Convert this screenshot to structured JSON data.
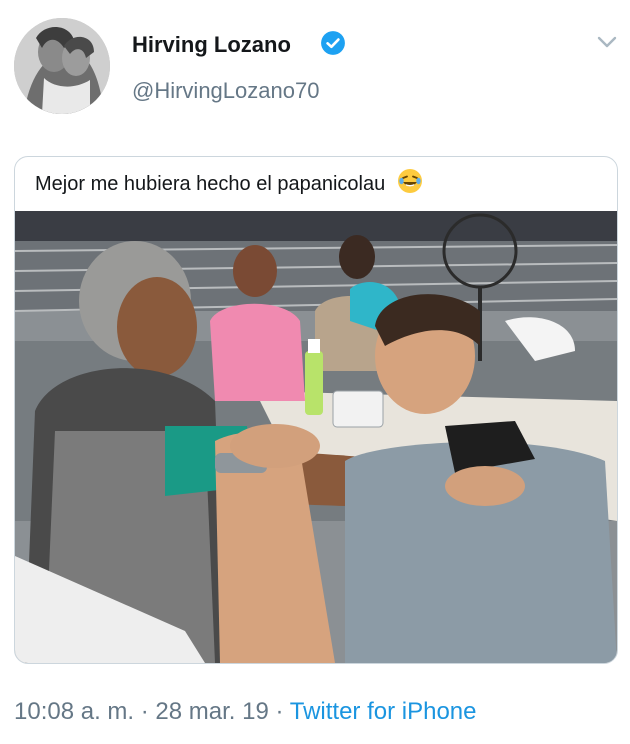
{
  "tweet": {
    "author_name": "Hirving Lozano",
    "author_handle": "@HirvingLozano70",
    "verified": true,
    "text": "Mejor me hubiera hecho el papanicolau",
    "emoji": "face-with-tears-of-joy",
    "time": "10:08 a. m.",
    "separator": "·",
    "date": "28 mar. 19",
    "source": "Twitter for iPhone"
  },
  "colors": {
    "name": "#14171a",
    "secondary": "#657786",
    "link": "#1b95e0",
    "verified": "#1da1f2",
    "border": "#ccd6dd"
  },
  "icons": [
    "verified-badge-icon",
    "chevron-down-icon",
    "emoji-laughing-icon"
  ]
}
